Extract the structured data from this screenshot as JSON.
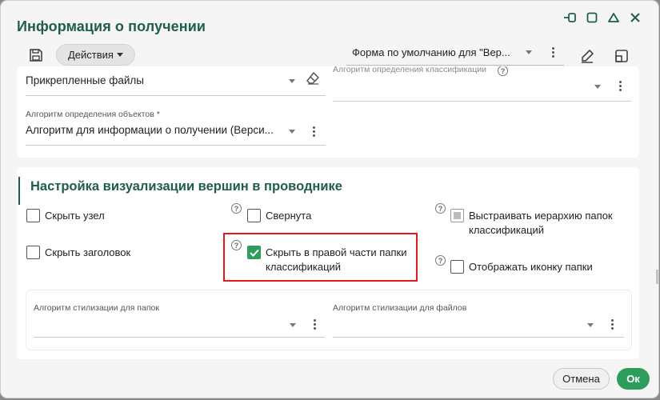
{
  "dialog": {
    "title": "Информация о получении"
  },
  "toolbar": {
    "actions_label": "Действия",
    "form_select_value": "Форма по умолчанию для \"Вер..."
  },
  "top_card": {
    "attached_files_value": "Прикрепленные файлы",
    "classification_algorithm_label": "Алгоритм определения классификации",
    "object_algorithm_label": "Алгоритм определения объектов *",
    "object_algorithm_value": "Алгоритм для информации о получении (Верси..."
  },
  "visual_section": {
    "title": "Настройка визуализации вершин в проводнике",
    "checkboxes": {
      "hide_node": {
        "label": "Скрыть узел",
        "checked": false
      },
      "collapsed": {
        "label": "Свернута",
        "checked": false
      },
      "build_hierarchy": {
        "label": "Выстраивать иерархию папок классификаций",
        "checked": "indeterminate"
      },
      "hide_header": {
        "label": "Скрыть заголовок",
        "checked": false
      },
      "hide_right_part": {
        "label": "Скрыть в правой части папки классификаций",
        "checked": true
      },
      "show_folder_icon": {
        "label": "Отображать иконку папки",
        "checked": false
      }
    },
    "help_symbol": "?"
  },
  "styling_card": {
    "folders_label": "Алгоритм стилизации для папок",
    "files_label": "Алгоритм стилизации для файлов"
  },
  "footer": {
    "cancel_label": "Отмена",
    "ok_label": "Ок"
  },
  "colors": {
    "accent_green": "#1f5e47",
    "checkbox_green": "#2e9d5c",
    "highlight_red": "#e01b1b"
  }
}
